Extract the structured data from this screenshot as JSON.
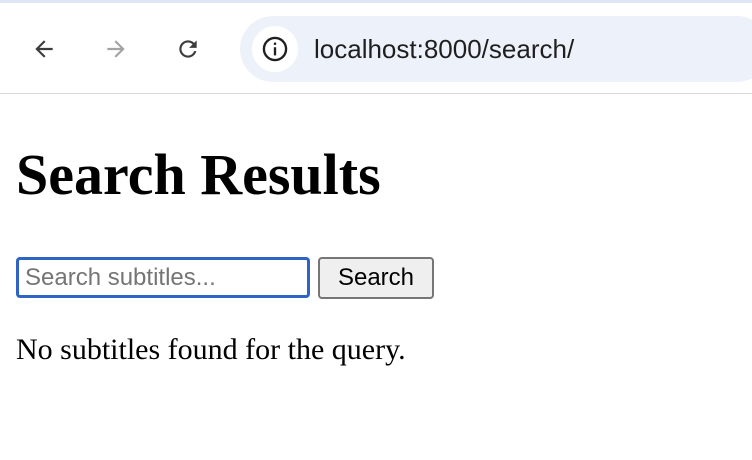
{
  "browser": {
    "url": "localhost:8000/search/",
    "icons": {
      "back": "back-arrow-icon",
      "forward": "forward-arrow-icon",
      "reload": "reload-icon",
      "site_info": "info-icon"
    },
    "colors": {
      "omnibox_bg": "#edf2fa",
      "forward_disabled": "#a3a3a3"
    }
  },
  "page": {
    "title": "Search Results",
    "search": {
      "placeholder": "Search subtitles...",
      "value": "",
      "button_label": "Search"
    },
    "message": "No subtitles found for the query."
  },
  "colors": {
    "input_focus_border": "#2f64c4"
  }
}
